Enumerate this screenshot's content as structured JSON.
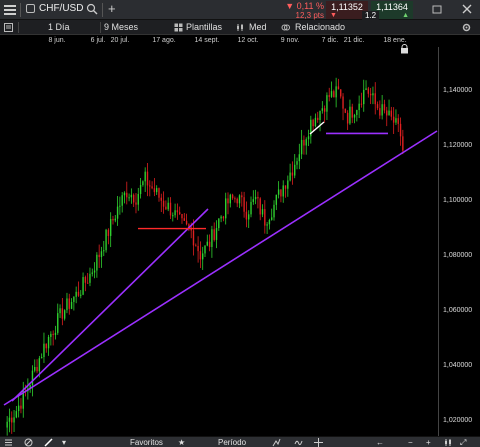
{
  "header": {
    "symbol": "CHF/USD",
    "change_pct": "▼ 0,11 %",
    "change_pts": "12,3 pts",
    "sell_price": "1,11352",
    "spread": "1.2",
    "buy_price": "1,11364"
  },
  "toolbar": {
    "interval": "1 Día",
    "range": "9 Meses",
    "templates": "Plantillas",
    "price_type": "Med",
    "related": "Relacionado"
  },
  "x_axis": {
    "ticks": [
      "8 jun.",
      "6 jul.",
      "20 jul.",
      "17 ago.",
      "14 sept.",
      "12 oct.",
      "9 nov.",
      "7 dic.",
      "21 dic.",
      "18 ene."
    ]
  },
  "y_axis": {
    "ticks": [
      "1,140000",
      "1,120000",
      "1,100000",
      "1,080000",
      "1,060000",
      "1,040000",
      "1,020000"
    ]
  },
  "footer": {
    "favorites": "Favoritos",
    "period": "Período"
  },
  "chart_data": {
    "type": "candlestick",
    "title": "",
    "ylim": [
      1.015,
      1.15
    ],
    "grid": false,
    "up_color": "#2fd12f",
    "down_color": "#e02020",
    "trendline_color": "#9b30ff",
    "approx_closes": [
      1.02,
      1.024,
      1.03,
      1.038,
      1.046,
      1.052,
      1.058,
      1.062,
      1.066,
      1.071,
      1.078,
      1.086,
      1.094,
      1.1,
      1.098,
      1.104,
      1.1,
      1.096,
      1.093,
      1.088,
      1.086,
      1.078,
      1.082,
      1.09,
      1.096,
      1.098,
      1.093,
      1.097,
      1.09,
      1.095,
      1.102,
      1.108,
      1.116,
      1.124,
      1.128,
      1.133,
      1.134,
      1.126,
      1.13,
      1.136,
      1.13,
      1.127,
      1.124,
      1.118
    ],
    "support_levels": [
      1.087,
      1.12
    ]
  }
}
